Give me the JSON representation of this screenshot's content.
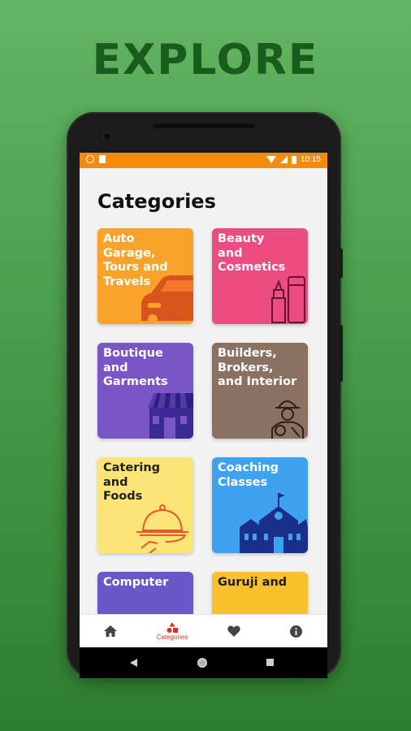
{
  "headline": "EXPLORE",
  "status_bar": {
    "time": "10:15"
  },
  "page_title": "Categories",
  "categories": [
    {
      "label": "Auto Garage, Tours and Travels",
      "lines": [
        "Auto Garage,",
        "Tours and",
        "Travels"
      ],
      "color": "#f8a32a",
      "icon": "car-icon"
    },
    {
      "label": "Beauty and Cosmetics",
      "lines": [
        "Beauty",
        "and",
        "Cosmetics"
      ],
      "color": "#ec4c7f",
      "icon": "cosmetics-icon"
    },
    {
      "label": "Boutique and Garments",
      "lines": [
        "Boutique",
        "and",
        "Garments"
      ],
      "color": "#7955c6",
      "icon": "storefront-icon"
    },
    {
      "label": "Builders, Brokers, and Interior",
      "lines": [
        "Builders,",
        "Brokers,",
        "and Interior"
      ],
      "color": "#8a7162",
      "icon": "builder-icon"
    },
    {
      "label": "Catering and Foods",
      "lines": [
        "Catering",
        "and",
        "Foods"
      ],
      "color": "#fbe476",
      "icon": "cloche-icon"
    },
    {
      "label": "Coaching Classes",
      "lines": [
        "Coaching",
        "Classes"
      ],
      "color": "#3fa2f0",
      "icon": "school-icon"
    },
    {
      "label": "Computer",
      "lines": [
        "Computer"
      ],
      "color": "#6a58c8",
      "icon": ""
    },
    {
      "label": "Guruji and",
      "lines": [
        "Guruji and"
      ],
      "color": "#f9c12c",
      "icon": ""
    }
  ],
  "bottom_nav": [
    {
      "label": "",
      "icon": "home-icon",
      "active": false
    },
    {
      "label": "Categories",
      "icon": "categories-icon",
      "active": true
    },
    {
      "label": "",
      "icon": "heart-icon",
      "active": false
    },
    {
      "label": "",
      "icon": "info-icon",
      "active": false
    }
  ],
  "colors": {
    "status_bar": "#f38b0b",
    "accent": "#e0311f",
    "background": "#4c9f4c",
    "headline": "#1a5c1e"
  }
}
